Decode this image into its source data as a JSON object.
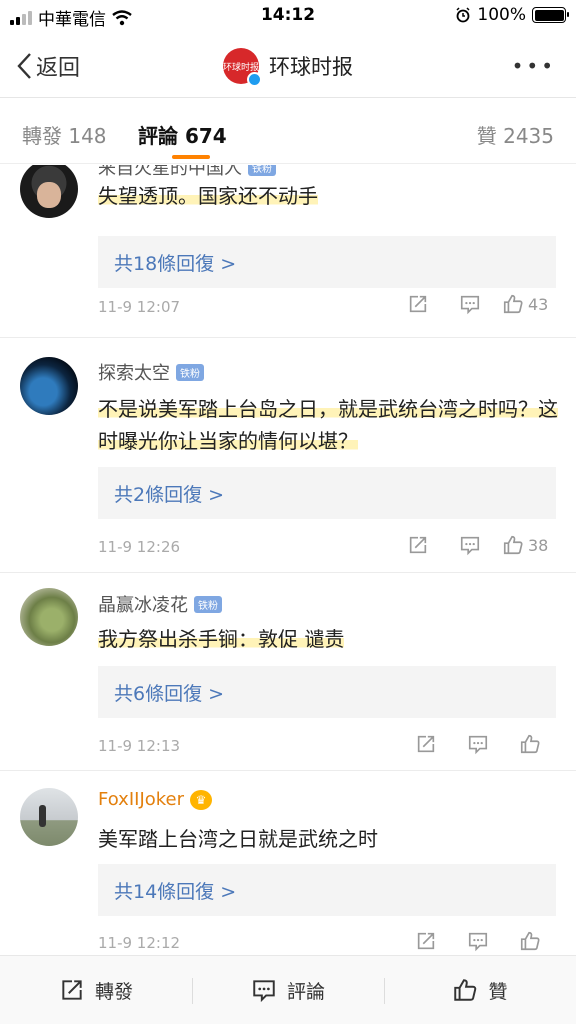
{
  "status_bar": {
    "carrier": "中華電信",
    "time": "14:12",
    "battery": "100%",
    "battery_level": 1.0
  },
  "nav": {
    "back_label": "返回",
    "title": "环球时报",
    "avatar_text": "环球时报"
  },
  "tabs": {
    "forward": "轉發 148",
    "comments": "評論 674",
    "likes": "贊 2435"
  },
  "comments": [
    {
      "user": "来自火星的中国人",
      "badge": "铁粉",
      "text": "失望透顶。国家还不动手",
      "replies": "共18條回復 >",
      "time": "11-9 12:07",
      "likes": "43"
    },
    {
      "user": "探索太空",
      "badge": "铁粉",
      "text": "不是说美军踏上台岛之日，就是武统台湾之时吗？这时曝光你让当家的情何以堪？",
      "replies": "共2條回復 >",
      "time": "11-9 12:26",
      "likes": "38"
    },
    {
      "user": "晶赢冰凌花",
      "badge": "铁粉",
      "text": "我方祭出杀手锏：敦促 谴责",
      "replies": "共6條回復 >",
      "time": "11-9 12:13",
      "likes": ""
    },
    {
      "user": "FoxIIJoker",
      "badge": "",
      "text": "美军踏上台湾之日就是武统之时",
      "replies": "共14條回復 >",
      "time": "11-9 12:12",
      "likes": ""
    }
  ],
  "bottom_bar": {
    "forward": "轉發",
    "comment": "評論",
    "like": "贊"
  },
  "colors": {
    "accent": "#ff8200",
    "link": "#4c78b9",
    "badge": "#7fa7e2",
    "brand": "#d7282a"
  }
}
